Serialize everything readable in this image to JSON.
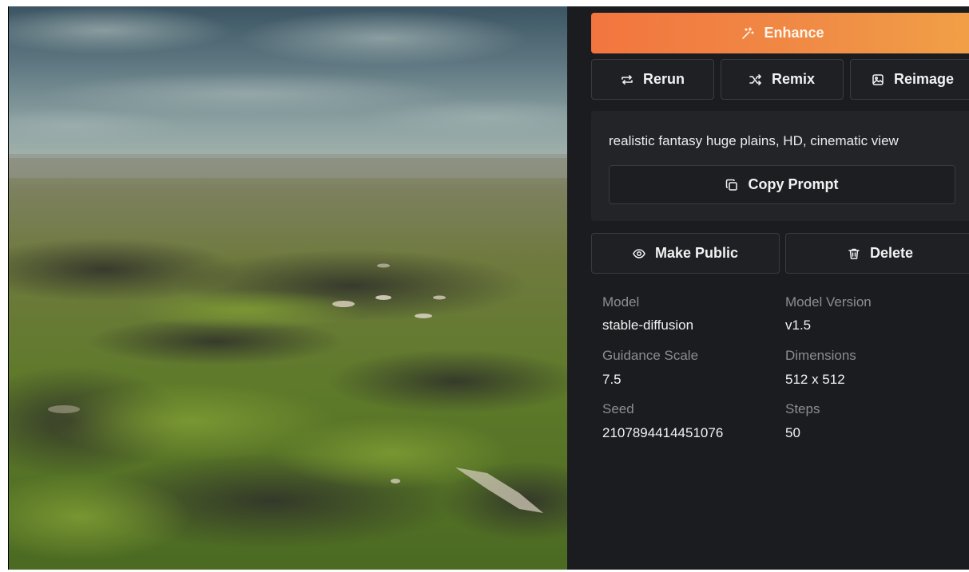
{
  "actions": {
    "enhance_label": "Enhance",
    "rerun_label": "Rerun",
    "remix_label": "Remix",
    "reimage_label": "Reimage",
    "copy_prompt_label": "Copy Prompt",
    "make_public_label": "Make Public",
    "delete_label": "Delete"
  },
  "prompt": {
    "text": "realistic fantasy huge plains, HD, cinematic view"
  },
  "details": {
    "model_label": "Model",
    "model_value": "stable-diffusion",
    "model_version_label": "Model Version",
    "model_version_value": "v1.5",
    "guidance_scale_label": "Guidance Scale",
    "guidance_scale_value": "7.5",
    "dimensions_label": "Dimensions",
    "dimensions_value": "512 x 512",
    "seed_label": "Seed",
    "seed_value": "2107894414451076",
    "steps_label": "Steps",
    "steps_value": "50"
  },
  "colors": {
    "enhance_gradient_start": "#f2753f",
    "enhance_gradient_end": "#f1a047",
    "panel_background": "#1b1c1f",
    "card_background": "#232428"
  },
  "icons": {
    "enhance": "magic-wand-icon",
    "rerun": "repeat-icon",
    "remix": "shuffle-icon",
    "reimage": "image-icon",
    "copy": "copy-icon",
    "make_public": "eye-icon",
    "delete": "trash-icon"
  }
}
